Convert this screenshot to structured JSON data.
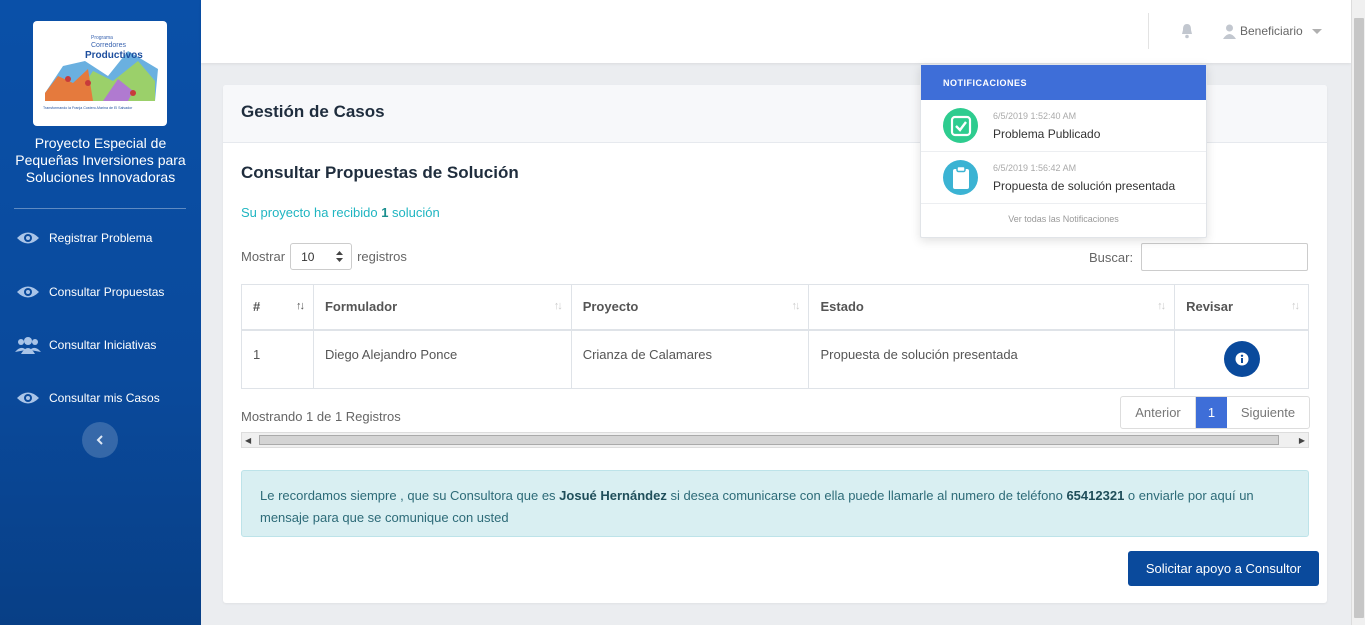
{
  "sidebar": {
    "title": "Proyecto Especial de Pequeñas Inversiones para Soluciones Innovadoras",
    "logo": {
      "program": "Programa",
      "name_line1": "Corredores",
      "name_line2": "Productivos",
      "tagline": "Transformando la Franja Costero-Marina de El Salvador"
    },
    "items": [
      {
        "label": "Registrar Problema",
        "icon": "eye-icon"
      },
      {
        "label": "Consultar Propuestas",
        "icon": "eye-icon"
      },
      {
        "label": "Consultar Iniciativas",
        "icon": "users-icon"
      },
      {
        "label": "Consultar mis Casos",
        "icon": "eye-icon"
      }
    ]
  },
  "topbar": {
    "user_label": "Beneficiario"
  },
  "card": {
    "title": "Gestión de Casos",
    "section_title": "Consultar Propuestas de Solución",
    "info_prefix": "Su proyecto ha recibido ",
    "info_count": "1",
    "info_suffix": " solución",
    "show_label": "Mostrar",
    "show_value": "10",
    "records_label": "registros",
    "search_label": "Buscar:",
    "table": {
      "headers": [
        "#",
        "Formulador",
        "Proyecto",
        "Estado",
        "Revisar"
      ],
      "rows": [
        {
          "num": "1",
          "formulador": "Diego Alejandro Ponce",
          "proyecto": "Crianza de Calamares",
          "estado": "Propuesta de solución presentada"
        }
      ]
    },
    "showing": "Mostrando 1 de 1 Registros",
    "pager": {
      "prev": "Anterior",
      "current": "1",
      "next": "Siguiente"
    },
    "alert": {
      "p1": "Le recordamos siempre , que su Consultora que es ",
      "consultant": "Josué Hernández",
      "p2": " si desea comunicarse con ella puede llamarle al numero de teléfono ",
      "phone": "65412321",
      "p3": " o enviarle por aquí un mensaje para que se comunique con usted"
    },
    "support_button": "Solicitar apoyo a Consultor"
  },
  "notifications": {
    "header": "NOTIFICACIONES",
    "items": [
      {
        "time": "6/5/2019 1:52:40 AM",
        "text": "Problema Publicado",
        "icon": "check-icon",
        "color": "#2ecc8f"
      },
      {
        "time": "6/5/2019 1:56:42 AM",
        "text": "Propuesta de solución presentada",
        "icon": "clipboard-icon",
        "color": "#3bb3d3"
      }
    ],
    "view_all": "Ver todas las Notificaciones"
  },
  "colors": {
    "sidebar": "#0a4a9c",
    "accent": "#3e6ed8",
    "primary_button": "#0a4a9c",
    "teal": "#1fb5c1"
  }
}
